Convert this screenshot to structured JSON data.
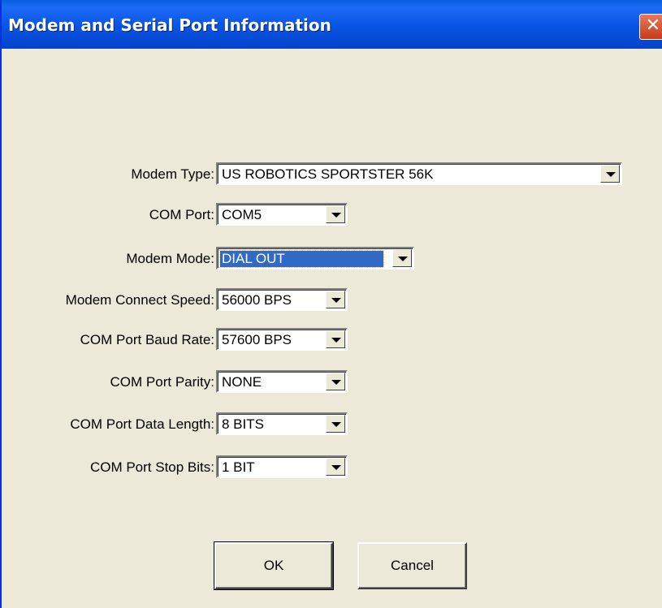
{
  "window": {
    "title": "Modem and Serial Port Information",
    "close_glyph": "✕"
  },
  "fields": {
    "modem_type": {
      "label": "Modem Type:",
      "value": "US ROBOTICS SPORTSTER 56K"
    },
    "com_port": {
      "label": "COM Port:",
      "value": "COM5"
    },
    "modem_mode": {
      "label": "Modem Mode:",
      "value": "DIAL OUT"
    },
    "connect_speed": {
      "label": "Modem Connect Speed:",
      "value": "56000 BPS"
    },
    "baud_rate": {
      "label": "COM Port Baud Rate:",
      "value": "57600 BPS"
    },
    "parity": {
      "label": "COM Port Parity:",
      "value": "NONE"
    },
    "data_length": {
      "label": "COM Port Data Length:",
      "value": "8 BITS"
    },
    "stop_bits": {
      "label": "COM Port Stop Bits:",
      "value": "1 BIT"
    }
  },
  "buttons": {
    "ok": "OK",
    "cancel": "Cancel"
  },
  "colors": {
    "titlebar": "#0854e3",
    "selection": "#316ac5",
    "face": "#ece9d8"
  }
}
